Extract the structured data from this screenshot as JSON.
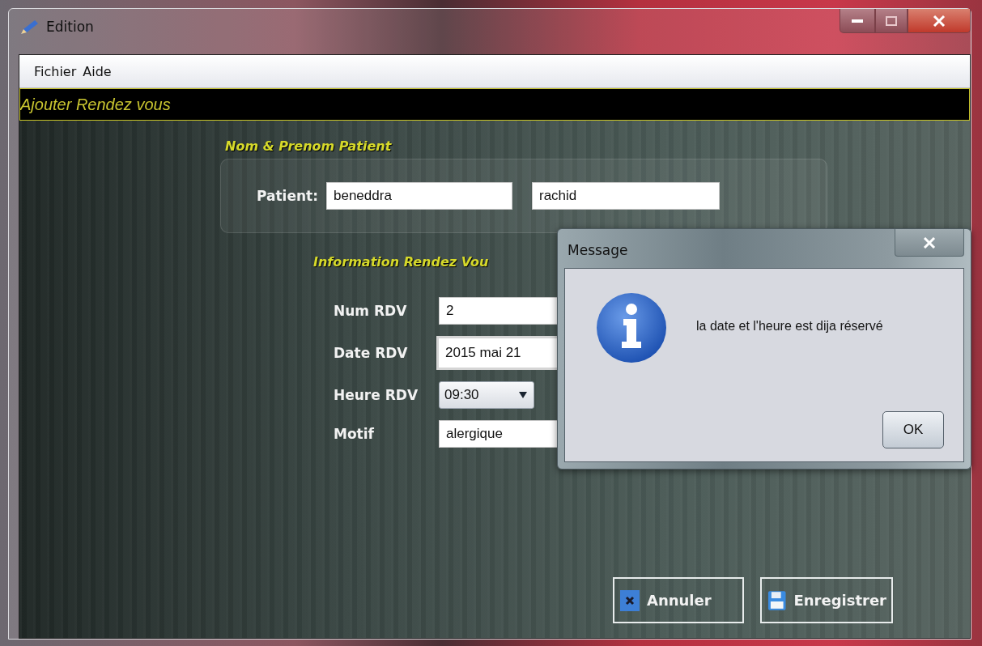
{
  "window": {
    "title": "Edition"
  },
  "menu": [
    "Fichier",
    "Aide"
  ],
  "banner": "Ajouter Rendez vous",
  "patient_group": {
    "title": "Nom & Prenom Patient",
    "label": "Patient:",
    "last_name": "beneddra",
    "first_name": "rachid"
  },
  "appointment_group": {
    "title": "Information Rendez Vou",
    "fields": [
      {
        "kind": "text",
        "label": "Num RDV",
        "value": "2"
      },
      {
        "kind": "date",
        "label": "Date RDV",
        "value": "2015 mai 21"
      },
      {
        "kind": "dropdown",
        "label": "Heure RDV",
        "value": "09:30"
      },
      {
        "kind": "text",
        "label": "Motif",
        "value": "alergique"
      }
    ]
  },
  "buttons": [
    {
      "kind": "cancel",
      "label": "Annuler"
    },
    {
      "kind": "save",
      "label": "Enregistrer"
    }
  ],
  "dialog": {
    "title": "Message",
    "message": "la date et l'heure est dija réservé",
    "button": "OK"
  }
}
